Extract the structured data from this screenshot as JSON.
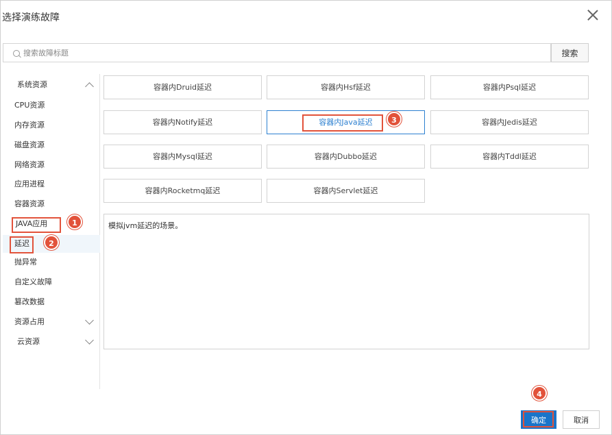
{
  "dialog": {
    "title": "选择演练故障"
  },
  "search": {
    "placeholder": "搜索故障标题",
    "button_label": "搜索"
  },
  "nav": [
    {
      "label": "系统资源",
      "type": "group",
      "chevron": "up"
    },
    {
      "label": "CPU资源",
      "type": "leaf"
    },
    {
      "label": "内存资源",
      "type": "leaf"
    },
    {
      "label": "磁盘资源",
      "type": "leaf"
    },
    {
      "label": "网络资源",
      "type": "leaf"
    },
    {
      "label": "应用进程",
      "type": "leaf"
    },
    {
      "label": "容器资源",
      "type": "leaf"
    },
    {
      "label": "JAVA应用",
      "type": "group",
      "chevron": "up"
    },
    {
      "label": "延迟",
      "type": "leaf",
      "selected": true
    },
    {
      "label": "抛异常",
      "type": "leaf"
    },
    {
      "label": "自定义故障",
      "type": "leaf"
    },
    {
      "label": "篡改数据",
      "type": "leaf"
    },
    {
      "label": "资源占用",
      "type": "leaf",
      "chevron": "down"
    },
    {
      "label": "云资源",
      "type": "group",
      "chevron": "down"
    }
  ],
  "faults": [
    {
      "label": "容器内Druid延迟"
    },
    {
      "label": "容器内Hsf延迟"
    },
    {
      "label": "容器内Psql延迟"
    },
    {
      "label": "容器内Notify延迟"
    },
    {
      "label": "容器内Java延迟",
      "active": true
    },
    {
      "label": "容器内Jedis延迟"
    },
    {
      "label": "容器内Mysql延迟"
    },
    {
      "label": "容器内Dubbo延迟"
    },
    {
      "label": "容器内Tddl延迟"
    },
    {
      "label": "容器内Rocketmq延迟"
    },
    {
      "label": "容器内Servlet延迟"
    }
  ],
  "description": "模拟jvm延迟的场景。",
  "footer": {
    "ok_label": "确定",
    "cancel_label": "取消"
  },
  "annotations": [
    "1",
    "2",
    "3",
    "4"
  ],
  "colors": {
    "accent": "#1a74c9",
    "annotation": "#e2523a"
  }
}
